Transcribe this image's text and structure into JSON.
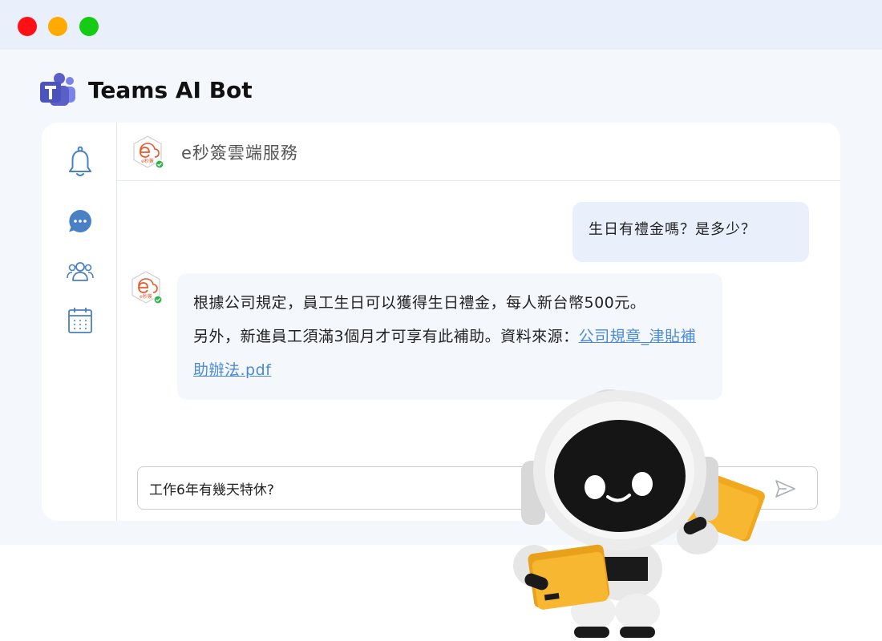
{
  "window": {
    "controls": [
      "close",
      "minimize",
      "maximize"
    ],
    "colors": {
      "close": "#ff1014",
      "minimize": "#ffaa00",
      "maximize": "#14cc14"
    }
  },
  "app": {
    "title": "Teams AI Bot",
    "logo_icon": "microsoft-teams-icon",
    "accent": "#5b5fc7"
  },
  "rail": {
    "items": [
      {
        "name": "notifications",
        "icon": "bell-icon"
      },
      {
        "name": "chat",
        "icon": "chat-bubble-icon"
      },
      {
        "name": "teams",
        "icon": "people-icon"
      },
      {
        "name": "calendar",
        "icon": "calendar-icon"
      }
    ]
  },
  "chat": {
    "title": "e秒簽雲端服務",
    "avatar_text": "e秒簽",
    "messages": [
      {
        "from": "user",
        "text": "生日有禮金嗎？是多少？"
      },
      {
        "from": "bot",
        "line1": "根據公司規定，員工生日可以獲得生日禮金，每人新台幣500元。",
        "line2_prefix": "另外，新進員工須滿3個月才可享有此補助。資料來源：",
        "link_text": "公司規章_津貼補助辦法.pdf"
      }
    ],
    "input": {
      "value": "工作6年有幾天特休?",
      "send_icon": "send-icon"
    }
  },
  "colors": {
    "brand_orange": "#e8572a",
    "link": "#4a8ad8",
    "verified": "#2db34a"
  }
}
